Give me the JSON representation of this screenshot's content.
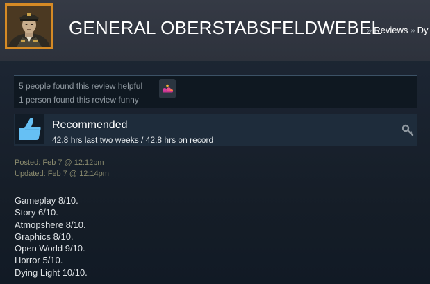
{
  "header": {
    "persona_name": "GENERAL OBERSTABSFELDWEBEL",
    "breadcrumbs": [
      {
        "sep": "»",
        "label": "Reviews"
      },
      {
        "sep": "»",
        "label": "Dy"
      }
    ]
  },
  "icons": {
    "avatar": "military-officer-portrait",
    "award": "award-icon",
    "thumb": "thumbs-up-icon",
    "key": "key-icon"
  },
  "colors": {
    "background": "#1b2838",
    "header_bg": "#2f343e",
    "avatar_border": "#d58a25",
    "accent_blue": "#66c0f4",
    "muted_text": "#8f98a0",
    "posted_text": "#8b8b6e"
  },
  "rating": {
    "helpful": "5 people found this review helpful",
    "funny": "1 person found this review funny"
  },
  "review": {
    "verdict": "Recommended",
    "hours": "42.8 hrs last two weeks / 42.8 hrs on record",
    "posted": "Posted: Feb 7 @ 12:12pm",
    "updated": "Updated: Feb 7 @ 12:14pm",
    "lines": [
      "Gameplay 8/10.",
      "Story 6/10.",
      "Atmopshere 8/10.",
      "Graphics 8/10.",
      "Open World 9/10.",
      "Horror 5/10.",
      "Dying Light 10/10."
    ]
  }
}
